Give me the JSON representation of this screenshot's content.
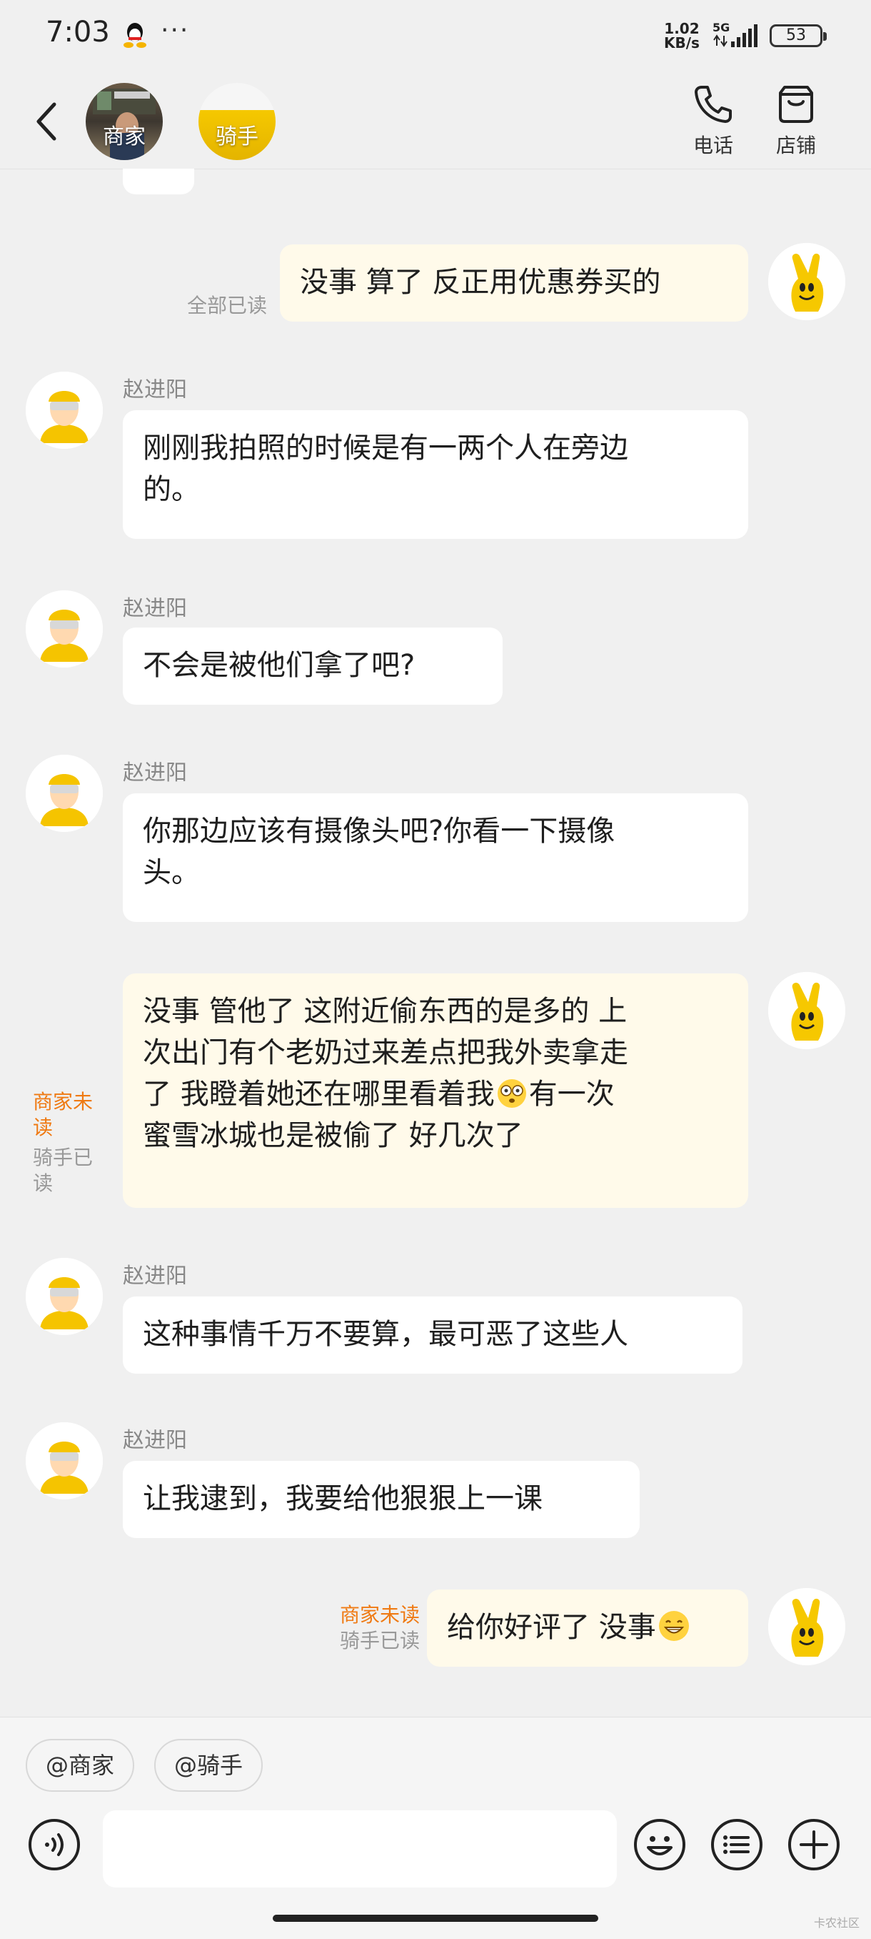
{
  "status": {
    "time": "7:03",
    "more": "···",
    "net_speed": "1.02",
    "net_unit": "KB/s",
    "network": "5G",
    "battery": "53",
    "icons": [
      "qq-icon",
      "signal-icon"
    ]
  },
  "header": {
    "back_icon": "chevron-left-icon",
    "groups": [
      {
        "label": "商家"
      },
      {
        "label": "骑手"
      }
    ],
    "actions": [
      {
        "label": "电话",
        "icon": "phone-icon"
      },
      {
        "label": "店铺",
        "icon": "store-icon"
      }
    ]
  },
  "messages": [
    {
      "side": "right",
      "text": "没事 算了 反正用优惠券买的",
      "read": "全部已读"
    },
    {
      "side": "left",
      "sender": "赵进阳",
      "line1": "刚刚我拍照的时候是有一两个人在旁边",
      "line2": "的。"
    },
    {
      "side": "left",
      "sender": "赵进阳",
      "text": "不会是被他们拿了吧?"
    },
    {
      "side": "left",
      "sender": "赵进阳",
      "line1": "你那边应该有摄像头吧?你看一下摄像",
      "line2": "头。"
    },
    {
      "side": "right",
      "line1": "没事 管他了 这附近偷东西的是多的 上",
      "line2": "次出门有个老奶过来差点把我外卖拿走",
      "line3a": "了 我瞪着她还在哪里看着我",
      "line3b": "有一次",
      "line4": "蜜雪冰城也是被偷了 好几次了",
      "read_unread_1": "商家未",
      "read_unread_2": "读",
      "read_read_1": "骑手已",
      "read_read_2": "读"
    },
    {
      "side": "left",
      "sender": "赵进阳",
      "text": "这种事情千万不要算，最可恶了这些人"
    },
    {
      "side": "left",
      "sender": "赵进阳",
      "text": "让我逮到，我要给他狠狠上一课"
    },
    {
      "side": "right",
      "text": "给你好评了 没事",
      "read_unread": "商家未读",
      "read_read": "骑手已读"
    }
  ],
  "bottom": {
    "chips": [
      "@商家",
      "@骑手"
    ],
    "input_placeholder": "",
    "icons": [
      "voice-icon",
      "emoji-icon",
      "quick-reply-icon",
      "add-icon"
    ]
  },
  "watermark": "卡农社区",
  "colors": {
    "background": "#f0f0f0",
    "bubble_other": "#ffffff",
    "bubble_me": "#fffaea",
    "unread": "#ef7a13",
    "read": "#999999",
    "brand_yellow": "#f5c800"
  }
}
